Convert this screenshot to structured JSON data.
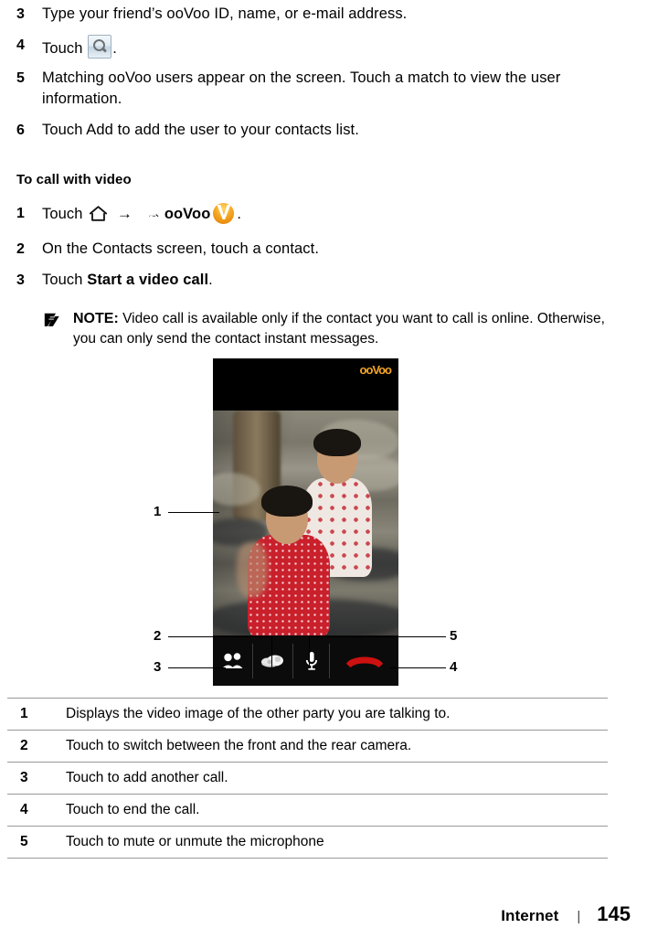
{
  "document": {
    "steps_group_1": [
      {
        "num": "3",
        "text": "Type your friend’s ooVoo ID, name, or e-mail address."
      },
      {
        "num": "4",
        "text_before": "Touch",
        "icon": "search-icon",
        "text_after": "."
      },
      {
        "num": "5",
        "text": "Matching ooVoo users appear on the screen. Touch a match to view the user information."
      },
      {
        "num": "6",
        "text": "Touch Add to add the user to your contacts list."
      }
    ],
    "section_heading": "To call with video",
    "steps_group_2": [
      {
        "num": "1",
        "text_before": "Touch",
        "icons": [
          "home-icon",
          "arrow-right-icon",
          "app-drawer-icon",
          "arrow-right-icon"
        ],
        "app_name": "ooVoo",
        "app_icon": "oovoo-logo-icon",
        "text_after": "."
      },
      {
        "num": "2",
        "text": "On the Contacts screen, touch a contact."
      },
      {
        "num": "3",
        "text_before": "Touch ",
        "bold": "Start a video call",
        "text_after": "."
      }
    ],
    "note": {
      "icon": "note-pencil-icon",
      "label": "NOTE:",
      "text": "Video call is available only if the contact you want to call is online. Otherwise, you can only send the contact instant messages."
    },
    "figure": {
      "app_logo_text": "ooVoo",
      "logo_color": "#f5a623",
      "controls": [
        {
          "name": "add-call-button",
          "icon": "people-add-icon"
        },
        {
          "name": "switch-camera-button",
          "icon": "camera-switch-icon"
        },
        {
          "name": "mute-microphone-button",
          "icon": "microphone-icon"
        },
        {
          "name": "end-call-button",
          "icon": "end-call-handset-icon",
          "color": "#cc1111"
        }
      ],
      "callouts": [
        "1",
        "2",
        "3",
        "4",
        "5"
      ]
    },
    "description_table": {
      "rows": [
        {
          "num": "1",
          "text": "Displays the video image of the other party you are talking to."
        },
        {
          "num": "2",
          "text": "Touch to switch between the front and the rear camera."
        },
        {
          "num": "3",
          "text": "Touch to add another call."
        },
        {
          "num": "4",
          "text": "Touch to end the call."
        },
        {
          "num": "5",
          "text": "Touch to mute or unmute the microphone"
        }
      ]
    },
    "footer": {
      "section": "Internet",
      "separator": "|",
      "page": "145"
    }
  }
}
